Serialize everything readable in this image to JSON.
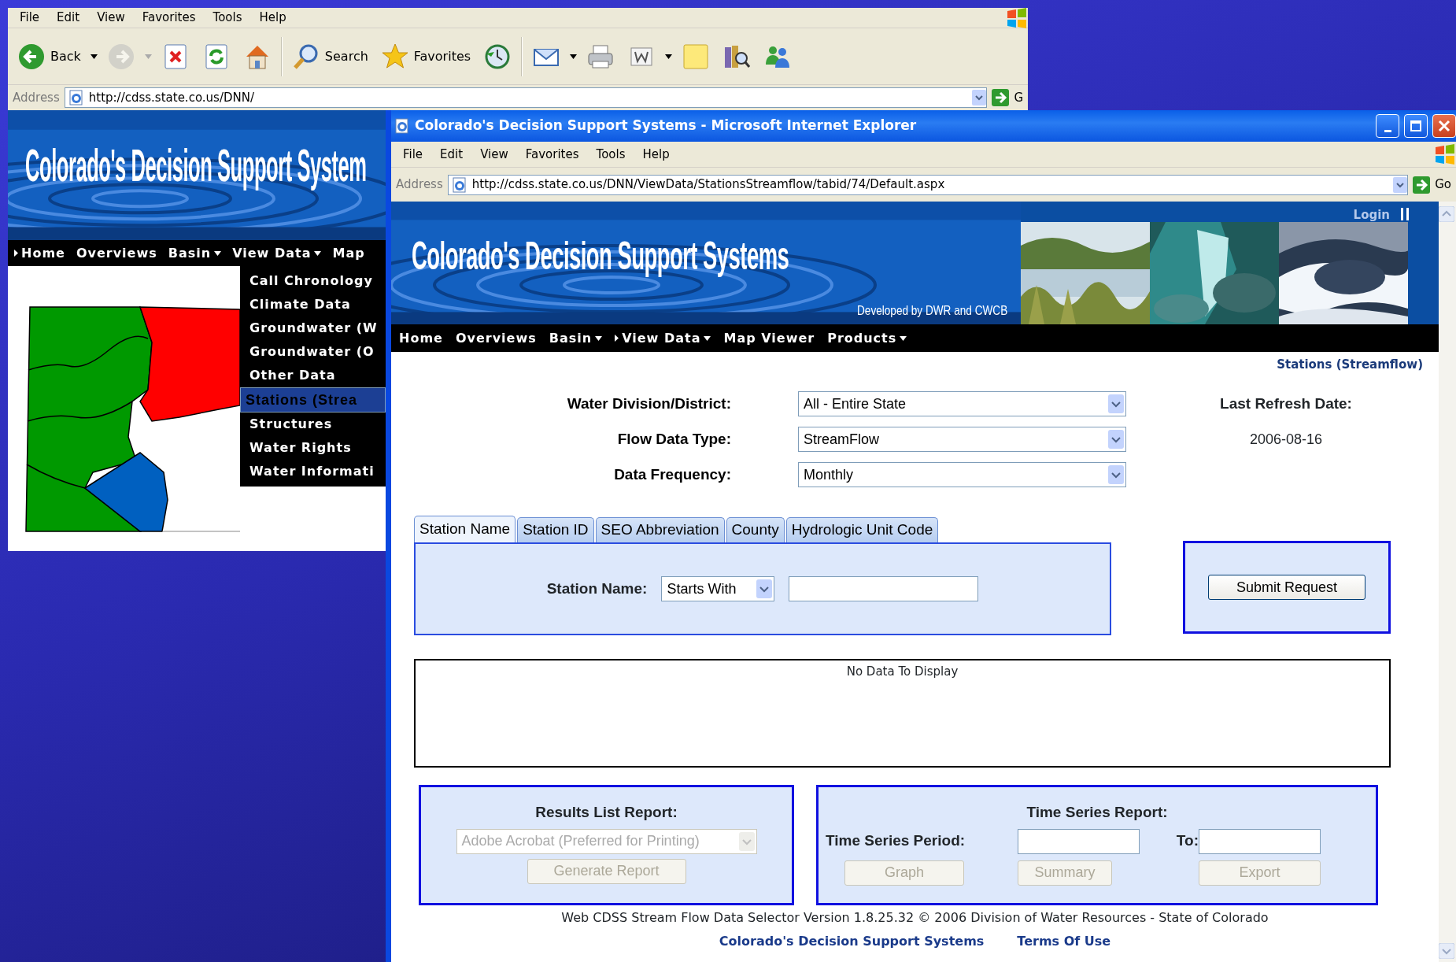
{
  "back_window": {
    "menu": [
      "File",
      "Edit",
      "View",
      "Favorites",
      "Tools",
      "Help"
    ],
    "toolbar": [
      {
        "kind": "back",
        "label": "Back",
        "dropdown": true,
        "disabled": false
      },
      {
        "kind": "forward",
        "dropdown": true,
        "disabled": true
      },
      {
        "kind": "stop",
        "dropdown": false,
        "disabled": false
      },
      {
        "kind": "refresh",
        "dropdown": false,
        "disabled": false
      },
      {
        "kind": "home",
        "dropdown": false,
        "disabled": false
      },
      {
        "kind": "separator"
      },
      {
        "kind": "search",
        "label": "Search",
        "dropdown": false,
        "disabled": false
      },
      {
        "kind": "favorites",
        "label": "Favorites",
        "dropdown": false,
        "disabled": false
      },
      {
        "kind": "history",
        "dropdown": false,
        "disabled": false
      },
      {
        "kind": "separator"
      },
      {
        "kind": "mail",
        "dropdown": true,
        "disabled": false
      },
      {
        "kind": "print",
        "dropdown": false,
        "disabled": false
      },
      {
        "kind": "word",
        "dropdown": true,
        "disabled": false
      },
      {
        "kind": "note",
        "dropdown": false,
        "disabled": false
      },
      {
        "kind": "research",
        "dropdown": false,
        "disabled": false
      },
      {
        "kind": "messenger",
        "dropdown": false,
        "disabled": false
      }
    ],
    "address_label": "Address",
    "address": "http://cdss.state.co.us/DNN/",
    "go": "G",
    "banner_title": "Colorado's Decision Support System",
    "nav": [
      {
        "label": "Home",
        "marker": true,
        "caret": false
      },
      {
        "label": "Overviews",
        "marker": false,
        "caret": false
      },
      {
        "label": "Basin",
        "marker": false,
        "caret": true
      },
      {
        "label": "View Data",
        "marker": false,
        "caret": true
      },
      {
        "label": "Map",
        "marker": false,
        "caret": false
      }
    ],
    "dropdown": [
      {
        "label": "Call Chronology",
        "selected": false
      },
      {
        "label": "Climate Data",
        "selected": false
      },
      {
        "label": "Groundwater (W",
        "selected": false
      },
      {
        "label": "Groundwater (O",
        "selected": false
      },
      {
        "label": "Other Data",
        "selected": false
      },
      {
        "label": "Stations (Strea",
        "selected": true
      },
      {
        "label": "Structures",
        "selected": false
      },
      {
        "label": "Water Rights",
        "selected": false
      },
      {
        "label": "Water Informati",
        "selected": false
      }
    ]
  },
  "front_window": {
    "title": "Colorado's Decision Support Systems - Microsoft Internet Explorer",
    "menu": [
      "File",
      "Edit",
      "View",
      "Favorites",
      "Tools",
      "Help"
    ],
    "address_label": "Address",
    "address": "http://cdss.state.co.us/DNN/ViewData/StationsStreamflow/tabid/74/Default.aspx",
    "go": "Go",
    "login": "Login",
    "banner_title": "Colorado's Decision Support Systems",
    "banner_subtitle": "Developed by DWR and CWCB",
    "nav": [
      {
        "label": "Home",
        "marker": false,
        "caret": false
      },
      {
        "label": "Overviews",
        "marker": false,
        "caret": false
      },
      {
        "label": "Basin",
        "marker": false,
        "caret": true
      },
      {
        "label": "View Data",
        "marker": true,
        "caret": true
      },
      {
        "label": "Map Viewer",
        "marker": false,
        "caret": false
      },
      {
        "label": "Products",
        "marker": false,
        "caret": true
      }
    ],
    "breadcrumb": "Stations (Streamflow)",
    "filters": [
      {
        "label": "Water Division/District:",
        "value": "All - Entire State"
      },
      {
        "label": "Flow Data Type:",
        "value": "StreamFlow"
      },
      {
        "label": "Data Frequency:",
        "value": "Monthly"
      }
    ],
    "refresh": {
      "label": "Last Refresh Date:",
      "value": "2006-08-16"
    },
    "tabs": [
      {
        "label": "Station Name",
        "selected": true
      },
      {
        "label": "Station ID",
        "selected": false
      },
      {
        "label": "SEO Abbreviation",
        "selected": false
      },
      {
        "label": "County",
        "selected": false
      },
      {
        "label": "Hydrologic Unit Code",
        "selected": false
      }
    ],
    "search": {
      "label": "Station Name:",
      "mode": "Starts With"
    },
    "submit": "Submit Request",
    "results": {
      "message": "No Data To Display"
    },
    "results_report": {
      "title": "Results List Report:",
      "format": "Adobe Acrobat (Preferred for Printing)",
      "button": "Generate Report",
      "disabled": true
    },
    "time_series": {
      "title": "Time Series Report:",
      "period_label": "Time Series Period:",
      "to_label": "To:",
      "buttons": [
        {
          "label": "Graph",
          "disabled": true
        },
        {
          "label": "Summary",
          "disabled": true
        },
        {
          "label": "Export",
          "disabled": true
        }
      ]
    },
    "footer": {
      "text": "Web CDSS Stream Flow Data Selector Version 1.8.25.32 © 2006 Division of Water Resources - State of Colorado",
      "links": [
        "Colorado's Decision Support Systems",
        "Terms Of Use"
      ]
    }
  }
}
